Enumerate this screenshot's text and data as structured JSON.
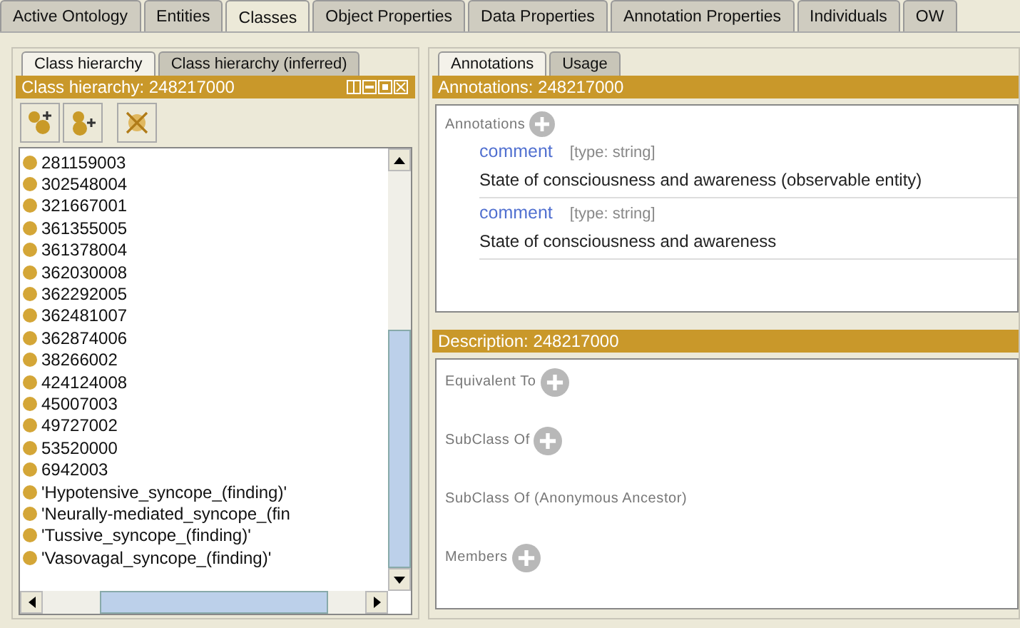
{
  "tabs": [
    {
      "label": "Active Ontology",
      "selected": false
    },
    {
      "label": "Entities",
      "selected": false
    },
    {
      "label": "Classes",
      "selected": true
    },
    {
      "label": "Object Properties",
      "selected": false
    },
    {
      "label": "Data Properties",
      "selected": false
    },
    {
      "label": "Annotation Properties",
      "selected": false
    },
    {
      "label": "Individuals",
      "selected": false
    },
    {
      "label": "OW",
      "selected": false
    }
  ],
  "left_panel": {
    "tabs": [
      {
        "label": "Class hierarchy",
        "selected": true
      },
      {
        "label": "Class hierarchy (inferred)",
        "selected": false
      }
    ],
    "title": "Class hierarchy: 248217000",
    "classes": [
      "281159003",
      "302548004",
      "321667001",
      "361355005",
      "361378004",
      "362030008",
      "362292005",
      "362481007",
      "362874006",
      "38266002",
      "424124008",
      "45007003",
      "49727002",
      "53520000",
      "6942003",
      "'Hypotensive_syncope_(finding)'",
      "'Neurally-mediated_syncope_(fin",
      "'Tussive_syncope_(finding)'",
      "'Vasovagal_syncope_(finding)'"
    ]
  },
  "annotations_panel": {
    "tabs": [
      {
        "label": "Annotations",
        "selected": true
      },
      {
        "label": "Usage",
        "selected": false
      }
    ],
    "title": "Annotations: 248217000",
    "section": "Annotations",
    "annotations": [
      {
        "property": "comment",
        "type": "[type: string]",
        "value": "State of consciousness and awareness (observable entity)"
      },
      {
        "property": "comment",
        "type": "[type: string]",
        "value": "State of consciousness and awareness"
      }
    ]
  },
  "description_panel": {
    "title": "Description: 248217000",
    "sections": [
      {
        "label": "Equivalent To",
        "has_add": true
      },
      {
        "label": "SubClass Of",
        "has_add": true
      },
      {
        "label": "SubClass Of (Anonymous Ancestor)",
        "has_add": false
      },
      {
        "label": "Members",
        "has_add": true
      }
    ]
  }
}
